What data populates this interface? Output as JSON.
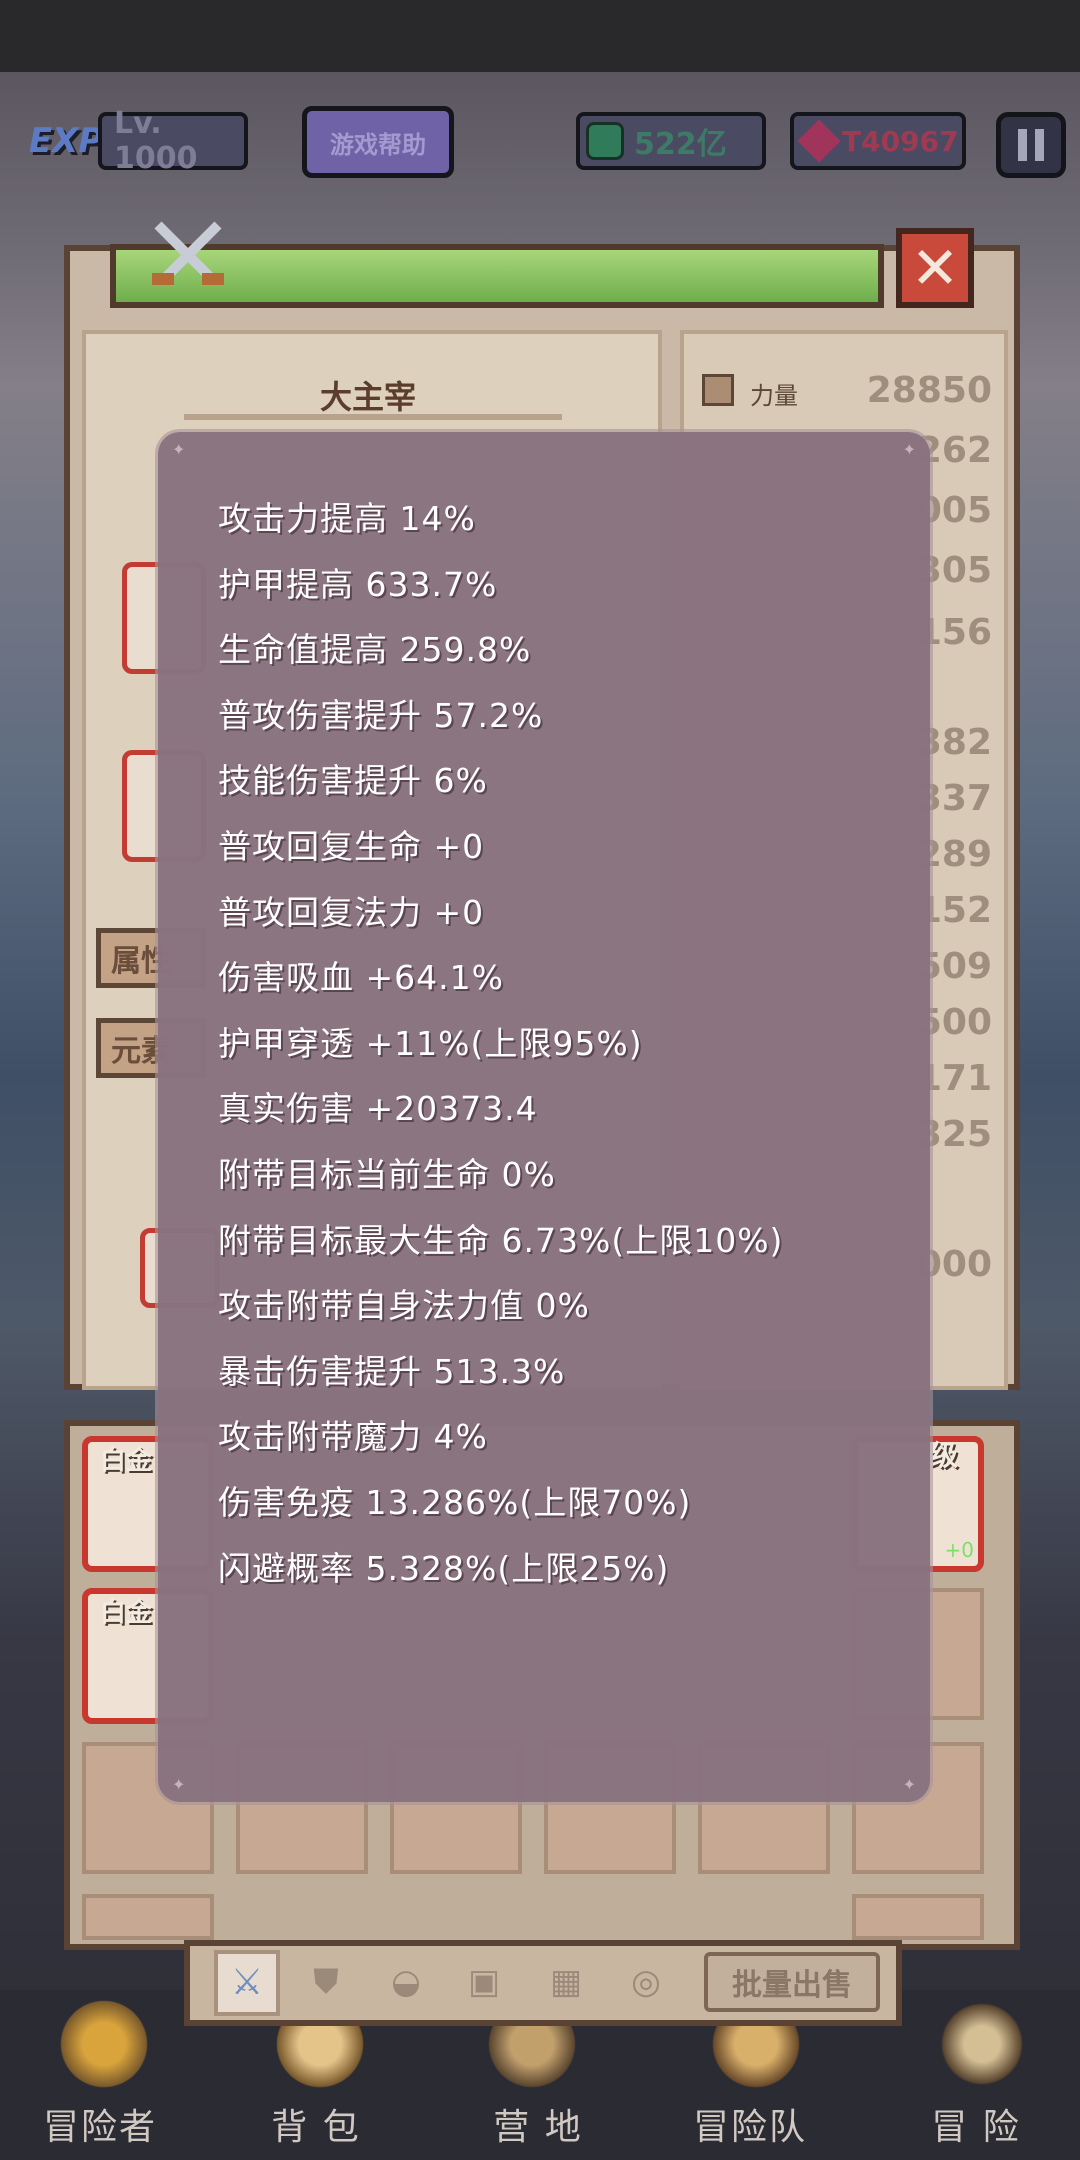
{
  "hud": {
    "level": "Lv. 1000",
    "help_label": "游戏帮助",
    "gems": "522亿",
    "rubies": "T40967"
  },
  "panel": {
    "character_name": "大主宰",
    "first_stat_label": "力量",
    "first_stat_value": "28850",
    "partial_stats": [
      "262",
      "005",
      "305",
      "156",
      "382",
      "337",
      "289",
      "152",
      "509",
      "500",
      "171",
      "325"
    ],
    "side_buttons": [
      "属性",
      "元素"
    ],
    "partial_value": "000"
  },
  "tooltip": {
    "lines": [
      "攻击力提高 14%",
      "护甲提高 633.7%",
      "生命值提高 259.8%",
      "普攻伤害提升 57.2%",
      "技能伤害提升 6%",
      "普攻回复生命 +0",
      "普攻回复法力 +0",
      "伤害吸血 +64.1%",
      "护甲穿透 +11%(上限95%)",
      "真实伤害 +20373.4",
      "附带目标当前生命 0%",
      "附带目标最大生命 6.73%(上限10%)",
      "攻击附带自身法力值 0%",
      "暴击伤害提升 513.3%",
      "攻击附带魔力 4%",
      "伤害免疫 13.286%(上限70%)",
      "闪避概率 5.328%(上限25%)"
    ]
  },
  "inventory": {
    "item_grade_1": "白金",
    "item_grade_2": "白金",
    "right_grade": "级",
    "right_plus": "+0",
    "sell_label": "批量出售"
  },
  "bottom_nav": [
    "冒险者",
    "背 包",
    "营 地",
    "冒险队",
    "冒 险"
  ]
}
